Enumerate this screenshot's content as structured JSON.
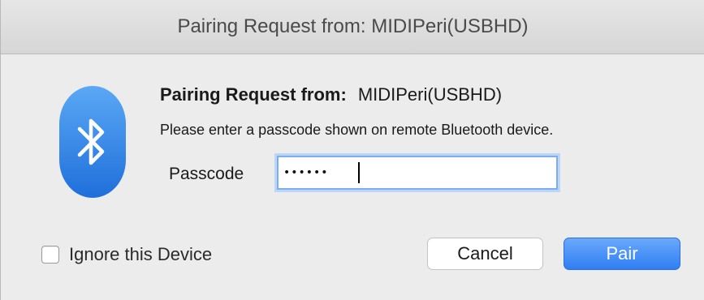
{
  "window": {
    "title": "Pairing Request from: MIDIPeri(USBHD)"
  },
  "header": {
    "label": "Pairing Request from:",
    "device_name": "MIDIPeri(USBHD)",
    "instruction": "Please enter a passcode shown on remote Bluetooth device."
  },
  "passcode": {
    "label": "Passcode",
    "value": "••••••"
  },
  "options": {
    "ignore_label": "Ignore this Device",
    "ignore_checked": false
  },
  "buttons": {
    "cancel": "Cancel",
    "pair": "Pair"
  },
  "icons": {
    "app": "bluetooth-icon"
  },
  "colors": {
    "accent": "#3a86f5",
    "icon_blue": "#2f7ee6"
  }
}
